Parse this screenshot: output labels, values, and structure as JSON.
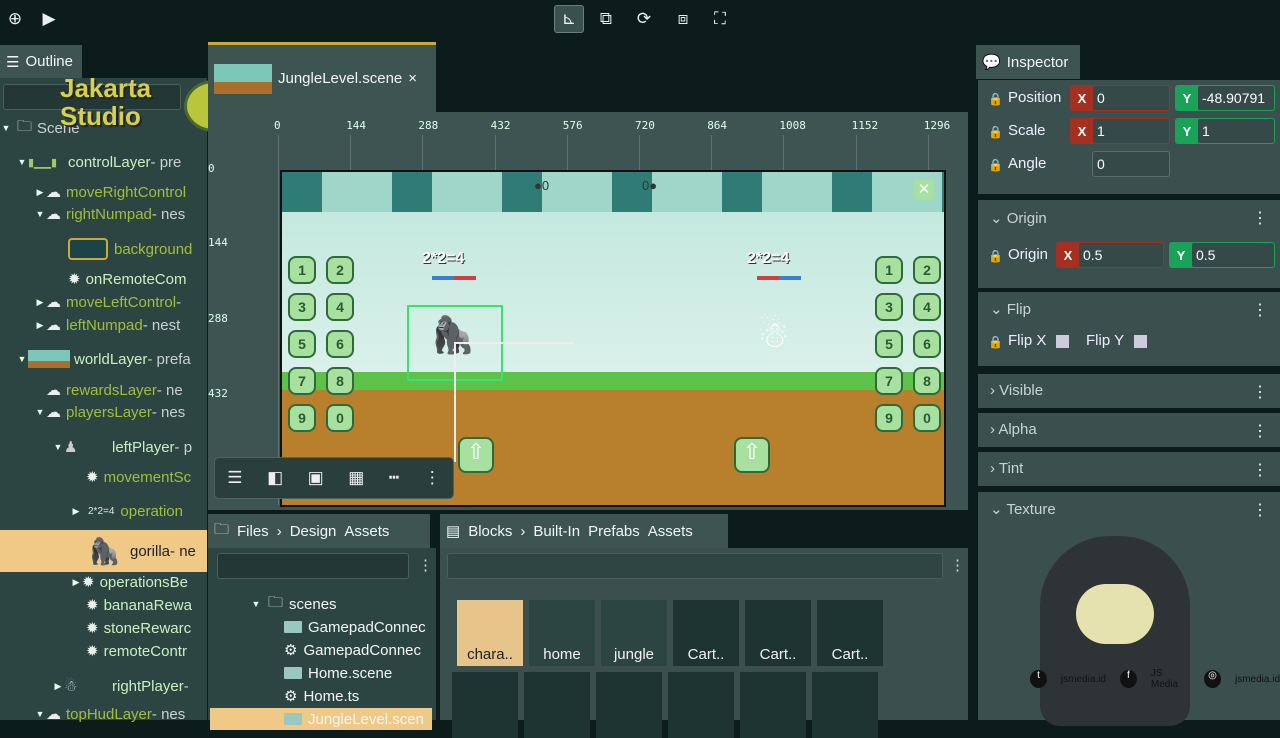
{
  "toolbar": {
    "left_icons": [
      "new-scene-icon",
      "play-icon"
    ],
    "tools": [
      {
        "name": "translate-tool",
        "glyph": "⊾",
        "active": true
      },
      {
        "name": "scale-tool",
        "glyph": "⧉",
        "active": false
      },
      {
        "name": "rotate-tool",
        "glyph": "⟳",
        "active": false
      },
      {
        "name": "resize-tool",
        "glyph": "⧈",
        "active": false
      },
      {
        "name": "fullscreen-tool",
        "glyph": "⛶",
        "active": false
      }
    ]
  },
  "watermark": {
    "line1": "Jakarta",
    "line2": "Studio"
  },
  "outline": {
    "title": "Outline",
    "search_placeholder": "",
    "items": [
      {
        "label": "Scene",
        "suffix": ""
      },
      {
        "label": "controlLayer",
        "suffix": " - pre"
      },
      {
        "label": "moveRightControl",
        "suffix": ""
      },
      {
        "label": "rightNumpad",
        "suffix": " - nes"
      },
      {
        "label": "background",
        "suffix": ""
      },
      {
        "label": "onRemoteCom",
        "suffix": ""
      },
      {
        "label": "moveLeftControl",
        "suffix": " -"
      },
      {
        "label": "leftNumpad",
        "suffix": " - nest"
      },
      {
        "label": "worldLayer",
        "suffix": " - prefa"
      },
      {
        "label": "rewardsLayer",
        "suffix": " - ne"
      },
      {
        "label": "playersLayer",
        "suffix": " - nes"
      },
      {
        "label": "leftPlayer",
        "suffix": " - p"
      },
      {
        "label": "movementSc",
        "suffix": ""
      },
      {
        "label": "operation",
        "suffix": "",
        "prefix": "2*2=4"
      },
      {
        "label": "gorilla",
        "suffix": " - ne"
      },
      {
        "label": "operationsBe",
        "suffix": ""
      },
      {
        "label": "bananaRewa",
        "suffix": ""
      },
      {
        "label": "stoneRewarc",
        "suffix": ""
      },
      {
        "label": "remoteContr",
        "suffix": ""
      },
      {
        "label": "rightPlayer",
        "suffix": " -"
      },
      {
        "label": "topHudLayer",
        "suffix": " - nes"
      }
    ]
  },
  "editor": {
    "tab_label": "JungleLevel.scene",
    "close": "×",
    "ruler_x": [
      "0",
      "144",
      "288",
      "432",
      "576",
      "720",
      "864",
      "1008",
      "1152",
      "1296"
    ],
    "ruler_y": [
      "0",
      "144",
      "288",
      "432"
    ],
    "scene": {
      "left_equation": "2*2=4",
      "right_equation": "2*2=4",
      "hud_left": "0",
      "hud_right": "0",
      "keys": [
        "1",
        "2",
        "3",
        "4",
        "5",
        "6",
        "7",
        "8",
        "9",
        "0"
      ]
    },
    "mini_toolbar": [
      "align-icon",
      "panel-left-icon",
      "image-icon",
      "grid-icon",
      "dash-icon",
      "more-icon"
    ]
  },
  "files": {
    "title": "Files",
    "breadcrumb": [
      "Design",
      "Assets"
    ],
    "search_placeholder": "",
    "items": [
      {
        "label": "scenes",
        "type": "folder"
      },
      {
        "label": "GamepadConnec",
        "type": "scene"
      },
      {
        "label": "GamepadConnec",
        "type": "ts"
      },
      {
        "label": "Home.scene",
        "type": "scene"
      },
      {
        "label": "Home.ts",
        "type": "ts"
      },
      {
        "label": "JungleLevel.scen",
        "type": "scene",
        "selected": true
      }
    ]
  },
  "blocks": {
    "title": "Blocks",
    "breadcrumb": [
      "Built-In",
      "Prefabs",
      "Assets"
    ],
    "search_placeholder": "",
    "row1": [
      "chara..",
      "home",
      "jungle",
      "Cart..",
      "Cart..",
      "Cart.."
    ]
  },
  "inspector": {
    "title": "Inspector",
    "position": {
      "label": "Position",
      "x": "0",
      "y": "-48.90791"
    },
    "scale": {
      "label": "Scale",
      "x": "1",
      "y": "1"
    },
    "angle": {
      "label": "Angle",
      "value": "0"
    },
    "origin_section": "Origin",
    "origin": {
      "label": "Origin",
      "x": "0.5",
      "y": "0.5"
    },
    "flip_section": "Flip",
    "flip": {
      "x_label": "Flip X",
      "y_label": "Flip Y",
      "x": false,
      "y": false
    },
    "visible_section": "Visible",
    "alpha_section": "Alpha",
    "tint_section": "Tint",
    "texture_section": "Texture",
    "axis_x": "X",
    "axis_y": "Y"
  },
  "social": {
    "twitter": "jsmedia.id",
    "facebook": "JS Media",
    "instagram": "jsmedia.id"
  },
  "colors": {
    "selection": "#f0c987",
    "axis_x": "#a53021",
    "axis_y": "#1aa258",
    "panel": "#2d4542",
    "prefab_text": "#9fbf3c"
  }
}
